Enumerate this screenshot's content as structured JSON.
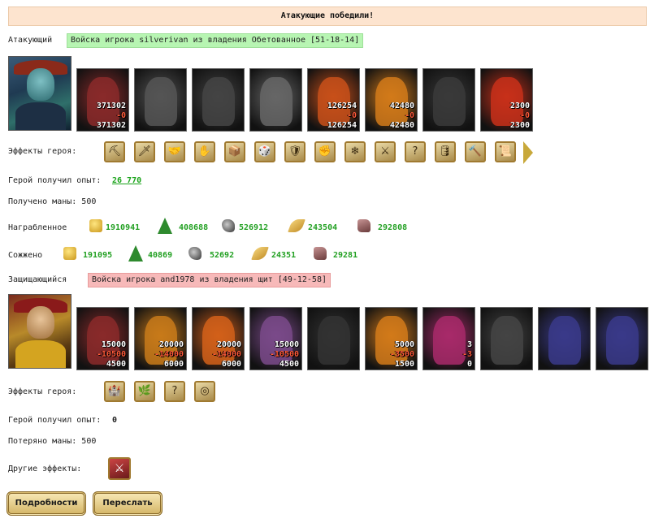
{
  "banner": "Атакующие победили!",
  "attacker": {
    "label": "Атакующий",
    "name": "Войска игрока silverivan из владения Обетованное [51-18-14]",
    "units": [
      {
        "n1": "371302",
        "n2": "-0",
        "n3": "371302",
        "color": "#8a2a2a"
      },
      {
        "n1": "",
        "n2": "",
        "n3": "",
        "color": "#555"
      },
      {
        "n1": "",
        "n2": "",
        "n3": "",
        "color": "#444"
      },
      {
        "n1": "",
        "n2": "",
        "n3": "",
        "color": "#666"
      },
      {
        "n1": "126254",
        "n2": "-0",
        "n3": "126254",
        "color": "#c8501a"
      },
      {
        "n1": "42480",
        "n2": "-0",
        "n3": "42480",
        "color": "#d27a1a"
      },
      {
        "n1": "",
        "n2": "",
        "n3": "",
        "color": "#3a3a3a"
      },
      {
        "n1": "2300",
        "n2": "-0",
        "n3": "2300",
        "color": "#c8301a"
      }
    ],
    "effects_label": "Эффекты героя:",
    "effects": [
      "⛏",
      "🗡",
      "🤝",
      "✋",
      "📦",
      "🎲",
      "🛡",
      "✊",
      "❄",
      "⚔",
      "?",
      "🛢",
      "🔨",
      "📜"
    ],
    "xp_label": "Герой получил опыт:",
    "xp": "26 770",
    "mana_label": "Получено маны: 500",
    "reward_label": "Награбленное",
    "reward": [
      "1910941",
      "408688",
      "526912",
      "243504",
      "292808"
    ],
    "burned_label": "Сожжено",
    "burned": [
      "191095",
      "40869",
      "52692",
      "24351",
      "29281"
    ]
  },
  "defender": {
    "label": "Защищающийся",
    "name": "Войска игрока and1978 из владения щит [49-12-58]",
    "units": [
      {
        "n1": "15000",
        "n2": "-10500",
        "n3": "4500",
        "color": "#8a2a2a"
      },
      {
        "n1": "20000",
        "n2": "-14000",
        "n3": "6000",
        "color": "#c87a1a"
      },
      {
        "n1": "20000",
        "n2": "-14000",
        "n3": "6000",
        "color": "#d2601a"
      },
      {
        "n1": "15000",
        "n2": "-10500",
        "n3": "4500",
        "color": "#7a4a8a"
      },
      {
        "n1": "",
        "n2": "",
        "n3": "",
        "color": "#333"
      },
      {
        "n1": "5000",
        "n2": "-3500",
        "n3": "1500",
        "color": "#d27a1a"
      },
      {
        "n1": "3",
        "n2": "-3",
        "n3": "0",
        "color": "#a82a6a"
      },
      {
        "n1": "",
        "n2": "",
        "n3": "",
        "color": "#444"
      },
      {
        "n1": "",
        "n2": "",
        "n3": "",
        "color": "#3a3a8a"
      },
      {
        "n1": "",
        "n2": "",
        "n3": "",
        "color": "#3a3a8a"
      }
    ],
    "effects_label": "Эффекты героя:",
    "effects": [
      "🏰",
      "🌿",
      "?",
      "◎"
    ],
    "xp_label": "Герой получил опыт:",
    "xp": "0",
    "mana_label": "Потеряно маны: 500",
    "other_label": "Другие эффекты:",
    "other_effect": "⚔"
  },
  "buttons": {
    "details": "Подробности",
    "forward": "Переслать"
  }
}
